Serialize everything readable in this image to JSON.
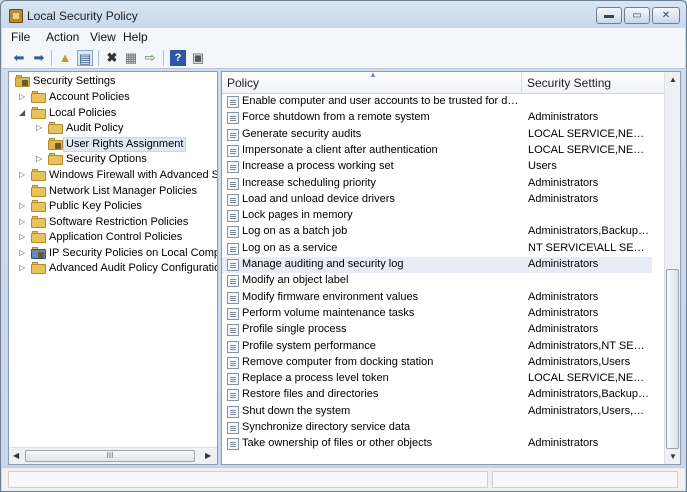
{
  "window": {
    "title": "Local Security Policy",
    "controls": {
      "minimize": "▬",
      "maximize": "▭",
      "close": "✕"
    }
  },
  "menu": [
    "File",
    "Action",
    "View",
    "Help"
  ],
  "toolbar": {
    "icons": [
      "back-icon",
      "forward-icon",
      "up-folder-icon",
      "show-hide-tree-icon",
      "delete-icon",
      "properties-icon",
      "export-list-icon",
      "help-icon",
      "view-icon"
    ]
  },
  "tree": {
    "root": "Security Settings",
    "items": [
      {
        "label": "Account Policies",
        "expanded": false
      },
      {
        "label": "Local Policies",
        "expanded": true
      },
      {
        "label": "Audit Policy",
        "expanded": false
      },
      {
        "label": "User Rights Assignment",
        "selected": true
      },
      {
        "label": "Security Options",
        "expanded": false
      },
      {
        "label": "Windows Firewall with Advanced Security",
        "expanded": false
      },
      {
        "label": "Network List Manager Policies"
      },
      {
        "label": "Public Key Policies",
        "expanded": false
      },
      {
        "label": "Software Restriction Policies",
        "expanded": false
      },
      {
        "label": "Application Control Policies",
        "expanded": false
      },
      {
        "label": "IP Security Policies on Local Computer",
        "expanded": false
      },
      {
        "label": "Advanced Audit Policy Configuration",
        "expanded": false
      }
    ],
    "hscroll_grip": "III"
  },
  "list": {
    "columns": {
      "policy": "Policy",
      "setting": "Security Setting"
    },
    "rows": [
      {
        "policy": "Enable computer and user accounts to be trusted for delega...",
        "setting": ""
      },
      {
        "policy": "Force shutdown from a remote system",
        "setting": "Administrators"
      },
      {
        "policy": "Generate security audits",
        "setting": "LOCAL SERVICE,NETWO..."
      },
      {
        "policy": "Impersonate a client after authentication",
        "setting": "LOCAL SERVICE,NETWO..."
      },
      {
        "policy": "Increase a process working set",
        "setting": "Users"
      },
      {
        "policy": "Increase scheduling priority",
        "setting": "Administrators"
      },
      {
        "policy": "Load and unload device drivers",
        "setting": "Administrators"
      },
      {
        "policy": "Lock pages in memory",
        "setting": ""
      },
      {
        "policy": "Log on as a batch job",
        "setting": "Administrators,Backup ..."
      },
      {
        "policy": "Log on as a service",
        "setting": "NT SERVICE\\ALL SERVIC..."
      },
      {
        "policy": "Manage auditing and security log",
        "setting": "Administrators",
        "highlighted": true
      },
      {
        "policy": "Modify an object label",
        "setting": ""
      },
      {
        "policy": "Modify firmware environment values",
        "setting": "Administrators"
      },
      {
        "policy": "Perform volume maintenance tasks",
        "setting": "Administrators"
      },
      {
        "policy": "Profile single process",
        "setting": "Administrators"
      },
      {
        "policy": "Profile system performance",
        "setting": "Administrators,NT SERVI..."
      },
      {
        "policy": "Remove computer from docking station",
        "setting": "Administrators,Users"
      },
      {
        "policy": "Replace a process level token",
        "setting": "LOCAL SERVICE,NETWO..."
      },
      {
        "policy": "Restore files and directories",
        "setting": "Administrators,Backup ..."
      },
      {
        "policy": "Shut down the system",
        "setting": "Administrators,Users,Ba..."
      },
      {
        "policy": "Synchronize directory service data",
        "setting": ""
      },
      {
        "policy": "Take ownership of files or other objects",
        "setting": "Administrators"
      }
    ]
  },
  "colors": {
    "selection": "#dfe8f4",
    "highlight_row": "#e6edf6",
    "folder": "#e8c35c"
  }
}
